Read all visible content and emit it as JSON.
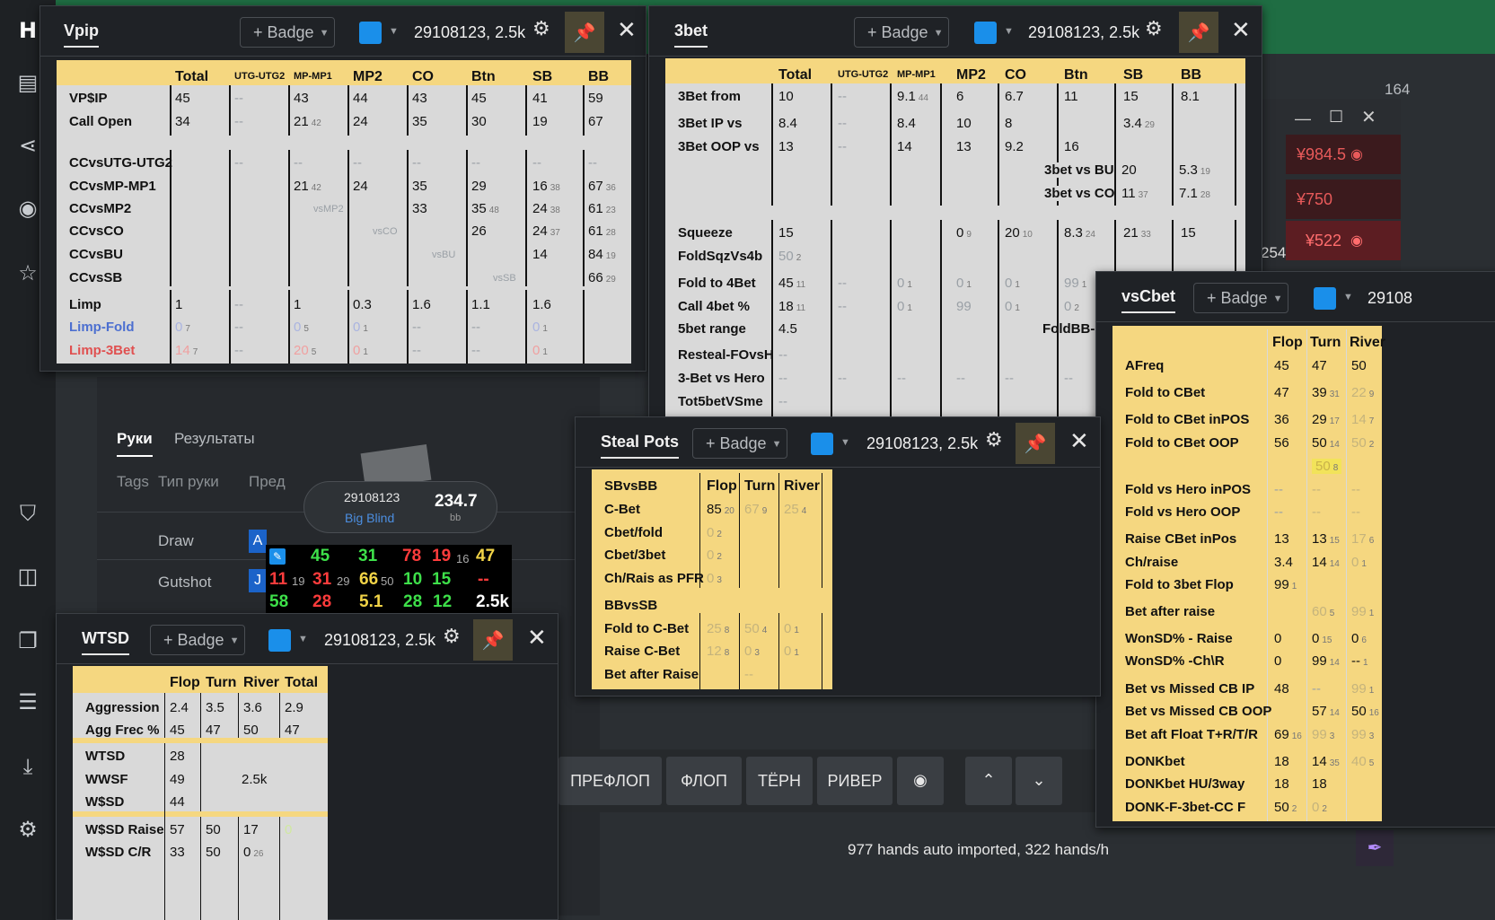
{
  "colors": {
    "accent": "#1a8fea",
    "pin": "#f2d447",
    "panel": "#f5d780",
    "green": "#1f6d43"
  },
  "sidebar": {
    "items": [
      {
        "name": "logo-icon",
        "glyph": "H"
      },
      {
        "name": "report-icon",
        "glyph": "▤"
      },
      {
        "name": "share-icon",
        "glyph": "⋖"
      },
      {
        "name": "broadcast-icon",
        "glyph": "◉"
      },
      {
        "name": "star-list-icon",
        "glyph": "☆"
      },
      {
        "name": "filter-icon",
        "glyph": "⛉"
      },
      {
        "name": "layout-icon",
        "glyph": "◫"
      },
      {
        "name": "stack-icon",
        "glyph": "❐"
      },
      {
        "name": "database-icon",
        "glyph": "☰"
      },
      {
        "name": "download-icon",
        "glyph": "⤓"
      },
      {
        "name": "settings-icon",
        "glyph": "⚙"
      }
    ]
  },
  "background": {
    "tabs": [
      "Руки",
      "Результаты"
    ],
    "subtabs": [
      "Tags",
      "Тип руки",
      "Пред"
    ],
    "rows": [
      "Draw",
      "Gutshot"
    ],
    "table_header_num": "164",
    "cards": [
      "A",
      "J"
    ],
    "prices": [
      "¥984.5",
      "¥750",
      "¥522"
    ],
    "mini_num": "254",
    "player_card": {
      "id": "29108123",
      "position": "Big Blind",
      "stack": "234.7",
      "unit": "bb"
    },
    "status": "977 hands auto imported, 322 hands/h",
    "street_buttons": [
      "ПРЕФЛОП",
      "ФЛОП",
      "ТЁРН",
      "РИВЕР"
    ]
  },
  "hud_common": {
    "badge": "+ Badge",
    "player": "29108123, 2.5k"
  },
  "stat_grid": [
    {
      "v": "45",
      "c": "#3ee04a"
    },
    {
      "v": "31",
      "c": "#3ee04a"
    },
    {
      "v": "78",
      "c": "#ff3c3c"
    },
    {
      "v": "19",
      "c": "#ff3c3c"
    },
    {
      "v": "16",
      "c": "#aaa"
    },
    {
      "v": "47",
      "c": "#f2d447"
    },
    {
      "v": "11",
      "c": "#ff3c3c"
    },
    {
      "v": "19",
      "c": "#aaa"
    },
    {
      "v": "31",
      "c": "#ff3c3c"
    },
    {
      "v": "29",
      "c": "#aaa"
    },
    {
      "v": "66",
      "c": "#f2d447"
    },
    {
      "v": "50",
      "c": "#aaa"
    },
    {
      "v": "10",
      "c": "#3ee04a"
    },
    {
      "v": "15",
      "c": "#3ee04a"
    },
    {
      "v": "--",
      "c": "#ff3c3c"
    },
    {
      "v": "58",
      "c": "#3ee04a"
    },
    {
      "v": "28",
      "c": "#ff3c3c"
    },
    {
      "v": "5.1",
      "c": "#f2d447"
    },
    {
      "v": "28",
      "c": "#3ee04a"
    },
    {
      "v": "12",
      "c": "#3ee04a"
    },
    {
      "v": "2.5k",
      "c": "#ffffff"
    }
  ],
  "vpip": {
    "title": "Vpip",
    "headers": [
      "Total",
      "UTG-UTG2",
      "MP-MP1",
      "MP2",
      "CO",
      "Btn",
      "SB",
      "BB"
    ],
    "rows": [
      {
        "label": "VP$IP",
        "cells": [
          "45",
          "--",
          "43",
          "44",
          "43",
          "45",
          "41",
          "59"
        ]
      },
      {
        "label": "Call Open",
        "cells": [
          "34",
          "--",
          "21 42",
          "24",
          "35",
          "30",
          "19",
          "67"
        ]
      },
      {
        "label": "CCvsUTG-UTG2",
        "cells": [
          "",
          "--",
          "--",
          "--",
          "--",
          "--",
          "--",
          "--"
        ]
      },
      {
        "label": "CCvsMP-MP1",
        "cells": [
          "",
          "",
          "21 42",
          "24",
          "35",
          "29",
          "16 38",
          "67 36"
        ]
      },
      {
        "label": "CCvsMP2",
        "cells": [
          "",
          "",
          "",
          "vsMP2",
          "33",
          "35 48",
          "24 38",
          "61 23"
        ]
      },
      {
        "label": "CCvsCO",
        "cells": [
          "",
          "",
          "",
          "",
          "vsCO",
          "26",
          "24 37",
          "61 28"
        ]
      },
      {
        "label": "CCvsBU",
        "cells": [
          "",
          "",
          "",
          "",
          "",
          "vsBU",
          "14",
          "84 19"
        ]
      },
      {
        "label": "CCvsSB",
        "cells": [
          "",
          "",
          "",
          "",
          "",
          "",
          "vsSB",
          "66 29"
        ]
      },
      {
        "label": "Limp",
        "cells": [
          "1",
          "--",
          "1",
          "0.3",
          "1.6",
          "1.1",
          "1.6",
          ""
        ]
      },
      {
        "label": "Limp-Fold",
        "cells": [
          "0 7",
          "--",
          "0 5",
          "0 1",
          "--",
          "--",
          "0 1",
          ""
        ]
      },
      {
        "label": "Limp-3Bet",
        "cells": [
          "14 7",
          "--",
          "20 5",
          "0 1",
          "--",
          "--",
          "0 1",
          ""
        ]
      }
    ]
  },
  "threebet": {
    "title": "3bet",
    "headers": [
      "Total",
      "UTG-UTG2",
      "MP-MP1",
      "MP2",
      "CO",
      "Btn",
      "SB",
      "BB"
    ],
    "rows": [
      {
        "label": "3Bet from",
        "cells": [
          "10",
          "--",
          "9.1 44",
          "6",
          "6.7",
          "11",
          "15",
          "8.1"
        ]
      },
      {
        "label": "3Bet IP vs",
        "cells": [
          "8.4",
          "--",
          "8.4",
          "10",
          "8",
          "",
          "3.4 29",
          ""
        ]
      },
      {
        "label": "3Bet OOP vs",
        "cells": [
          "13",
          "--",
          "14",
          "13",
          "9.2",
          "16",
          "",
          ""
        ]
      },
      {
        "label": "3bet vs BU",
        "cells": [
          "20",
          "5.3 19"
        ]
      },
      {
        "label": "3bet vs CO",
        "cells": [
          "11 37",
          "7.1 28"
        ]
      },
      {
        "label": "Squeeze",
        "cells": [
          "15",
          "",
          "",
          "0 9",
          "20 10",
          "8.3 24",
          "21 33",
          "15"
        ]
      },
      {
        "label": "FoldSqzVs4b",
        "cells": [
          "50 2",
          "",
          "",
          "",
          "",
          "",
          "",
          ""
        ]
      },
      {
        "label": "Fold to 4Bet",
        "cells": [
          "45 11",
          "--",
          "0 1",
          "0 1",
          "0 1",
          "99 1",
          "",
          ""
        ]
      },
      {
        "label": "Call 4bet %",
        "cells": [
          "18 11",
          "--",
          "0 1",
          "99",
          "0 1",
          "0 2",
          "",
          ""
        ]
      },
      {
        "label": "5bet range",
        "cells": [
          "4.5",
          "",
          "",
          "",
          "",
          "FoldBB-I",
          "",
          ""
        ]
      },
      {
        "label": "Resteal-FOvsH",
        "cells": [
          "--",
          "",
          "",
          "",
          "",
          "",
          "",
          ""
        ]
      },
      {
        "label": "3-Bet vs Hero",
        "cells": [
          "--",
          "--",
          "--",
          "--",
          "--",
          "--",
          "",
          ""
        ]
      },
      {
        "label": "Tot5betVSme",
        "cells": [
          "--",
          "",
          "",
          "",
          "",
          "",
          "",
          ""
        ]
      }
    ]
  },
  "steal": {
    "title": "Steal Pots",
    "headers": [
      "Flop",
      "Turn",
      "River"
    ],
    "rows": [
      {
        "label": "SBvsBB",
        "cells": [
          "",
          "",
          ""
        ]
      },
      {
        "label": "C-Bet",
        "cells": [
          "85 20",
          "67 9",
          "25 4"
        ]
      },
      {
        "label": "Cbet/fold",
        "cells": [
          "0 2",
          "",
          ""
        ]
      },
      {
        "label": "Cbet/3bet",
        "cells": [
          "0 2",
          "",
          ""
        ]
      },
      {
        "label": "Ch/Rais as PFR",
        "cells": [
          "0 3",
          "",
          ""
        ]
      },
      {
        "label": "BBvsSB",
        "cells": [
          "",
          "",
          ""
        ]
      },
      {
        "label": "Fold to C-Bet",
        "cells": [
          "25 8",
          "50 4",
          "0 1"
        ]
      },
      {
        "label": "Raise C-Bet",
        "cells": [
          "12 8",
          "0 3",
          "0 1"
        ]
      },
      {
        "label": "Bet after Raise",
        "cells": [
          "",
          "--",
          ""
        ]
      }
    ]
  },
  "wtsd": {
    "title": "WTSD",
    "headers": [
      "Flop",
      "Turn",
      "River",
      "Total"
    ],
    "rows": [
      {
        "label": "Aggression",
        "cells": [
          "2.4",
          "3.5",
          "3.6",
          "2.9"
        ]
      },
      {
        "label": "Agg Frec %",
        "cells": [
          "45",
          "47",
          "50",
          "47"
        ]
      },
      {
        "label": "WTSD",
        "cells": [
          "28"
        ]
      },
      {
        "label": "WWSF",
        "cells": [
          "49",
          "2.5k"
        ]
      },
      {
        "label": "W$SD",
        "cells": [
          "44"
        ]
      },
      {
        "label": "W$SD Raise",
        "cells": [
          "57",
          "50",
          "17",
          "0"
        ]
      },
      {
        "label": "W$SD C/R",
        "cells": [
          "33",
          "50",
          "0 26"
        ]
      }
    ]
  },
  "vscbet": {
    "title": "vsCbet",
    "player": "29108",
    "headers": [
      "Flop",
      "Turn",
      "River"
    ],
    "rows": [
      {
        "label": "AFreq",
        "cells": [
          "45",
          "47",
          "50"
        ]
      },
      {
        "label": "Fold to CBet",
        "cells": [
          "47",
          "39 31",
          "22 9"
        ]
      },
      {
        "label": "Fold to CBet inPOS",
        "cells": [
          "36",
          "29 17",
          "14 7"
        ]
      },
      {
        "label": "Fold to CBet OOP",
        "cells": [
          "56",
          "50 14",
          "50 2"
        ]
      },
      {
        "label": "",
        "cells": [
          "",
          "50 8",
          ""
        ]
      },
      {
        "label": "Fold vs Hero inPOS",
        "cells": [
          "--",
          "--",
          "--"
        ]
      },
      {
        "label": "Fold vs Hero OOP",
        "cells": [
          "--",
          "--",
          "--"
        ]
      },
      {
        "label": "Raise CBet inPos",
        "cells": [
          "13",
          "13 15",
          "17 6"
        ]
      },
      {
        "label": "Ch/raise",
        "cells": [
          "3.4",
          "14 14",
          "0 1"
        ]
      },
      {
        "label": "Fold to 3bet Flop",
        "cells": [
          "99 1",
          "",
          ""
        ]
      },
      {
        "label": "Bet after raise",
        "cells": [
          "",
          "60 5",
          "99 1"
        ]
      },
      {
        "label": "WonSD% - Raise",
        "cells": [
          "0",
          "0 15",
          "0 6"
        ]
      },
      {
        "label": "WonSD% -Ch\\R",
        "cells": [
          "0",
          "99 14",
          "-- 1"
        ]
      },
      {
        "label": "Bet vs Missed CB IP",
        "cells": [
          "48",
          "--",
          "99 1"
        ]
      },
      {
        "label": "Bet vs Missed CB OOP",
        "cells": [
          "",
          "57 14",
          "50 16"
        ]
      },
      {
        "label": "Bet aft Float T+R/T/R",
        "cells": [
          "69 16",
          "99 3",
          "99 3"
        ]
      },
      {
        "label": "DONKbet",
        "cells": [
          "18",
          "14 35",
          "40 5"
        ]
      },
      {
        "label": "DONKbet HU/3way",
        "cells": [
          "18",
          "18",
          ""
        ]
      },
      {
        "label": "DONK-F-3bet-CC F",
        "cells": [
          "50 2",
          "0 2",
          ""
        ]
      }
    ]
  }
}
